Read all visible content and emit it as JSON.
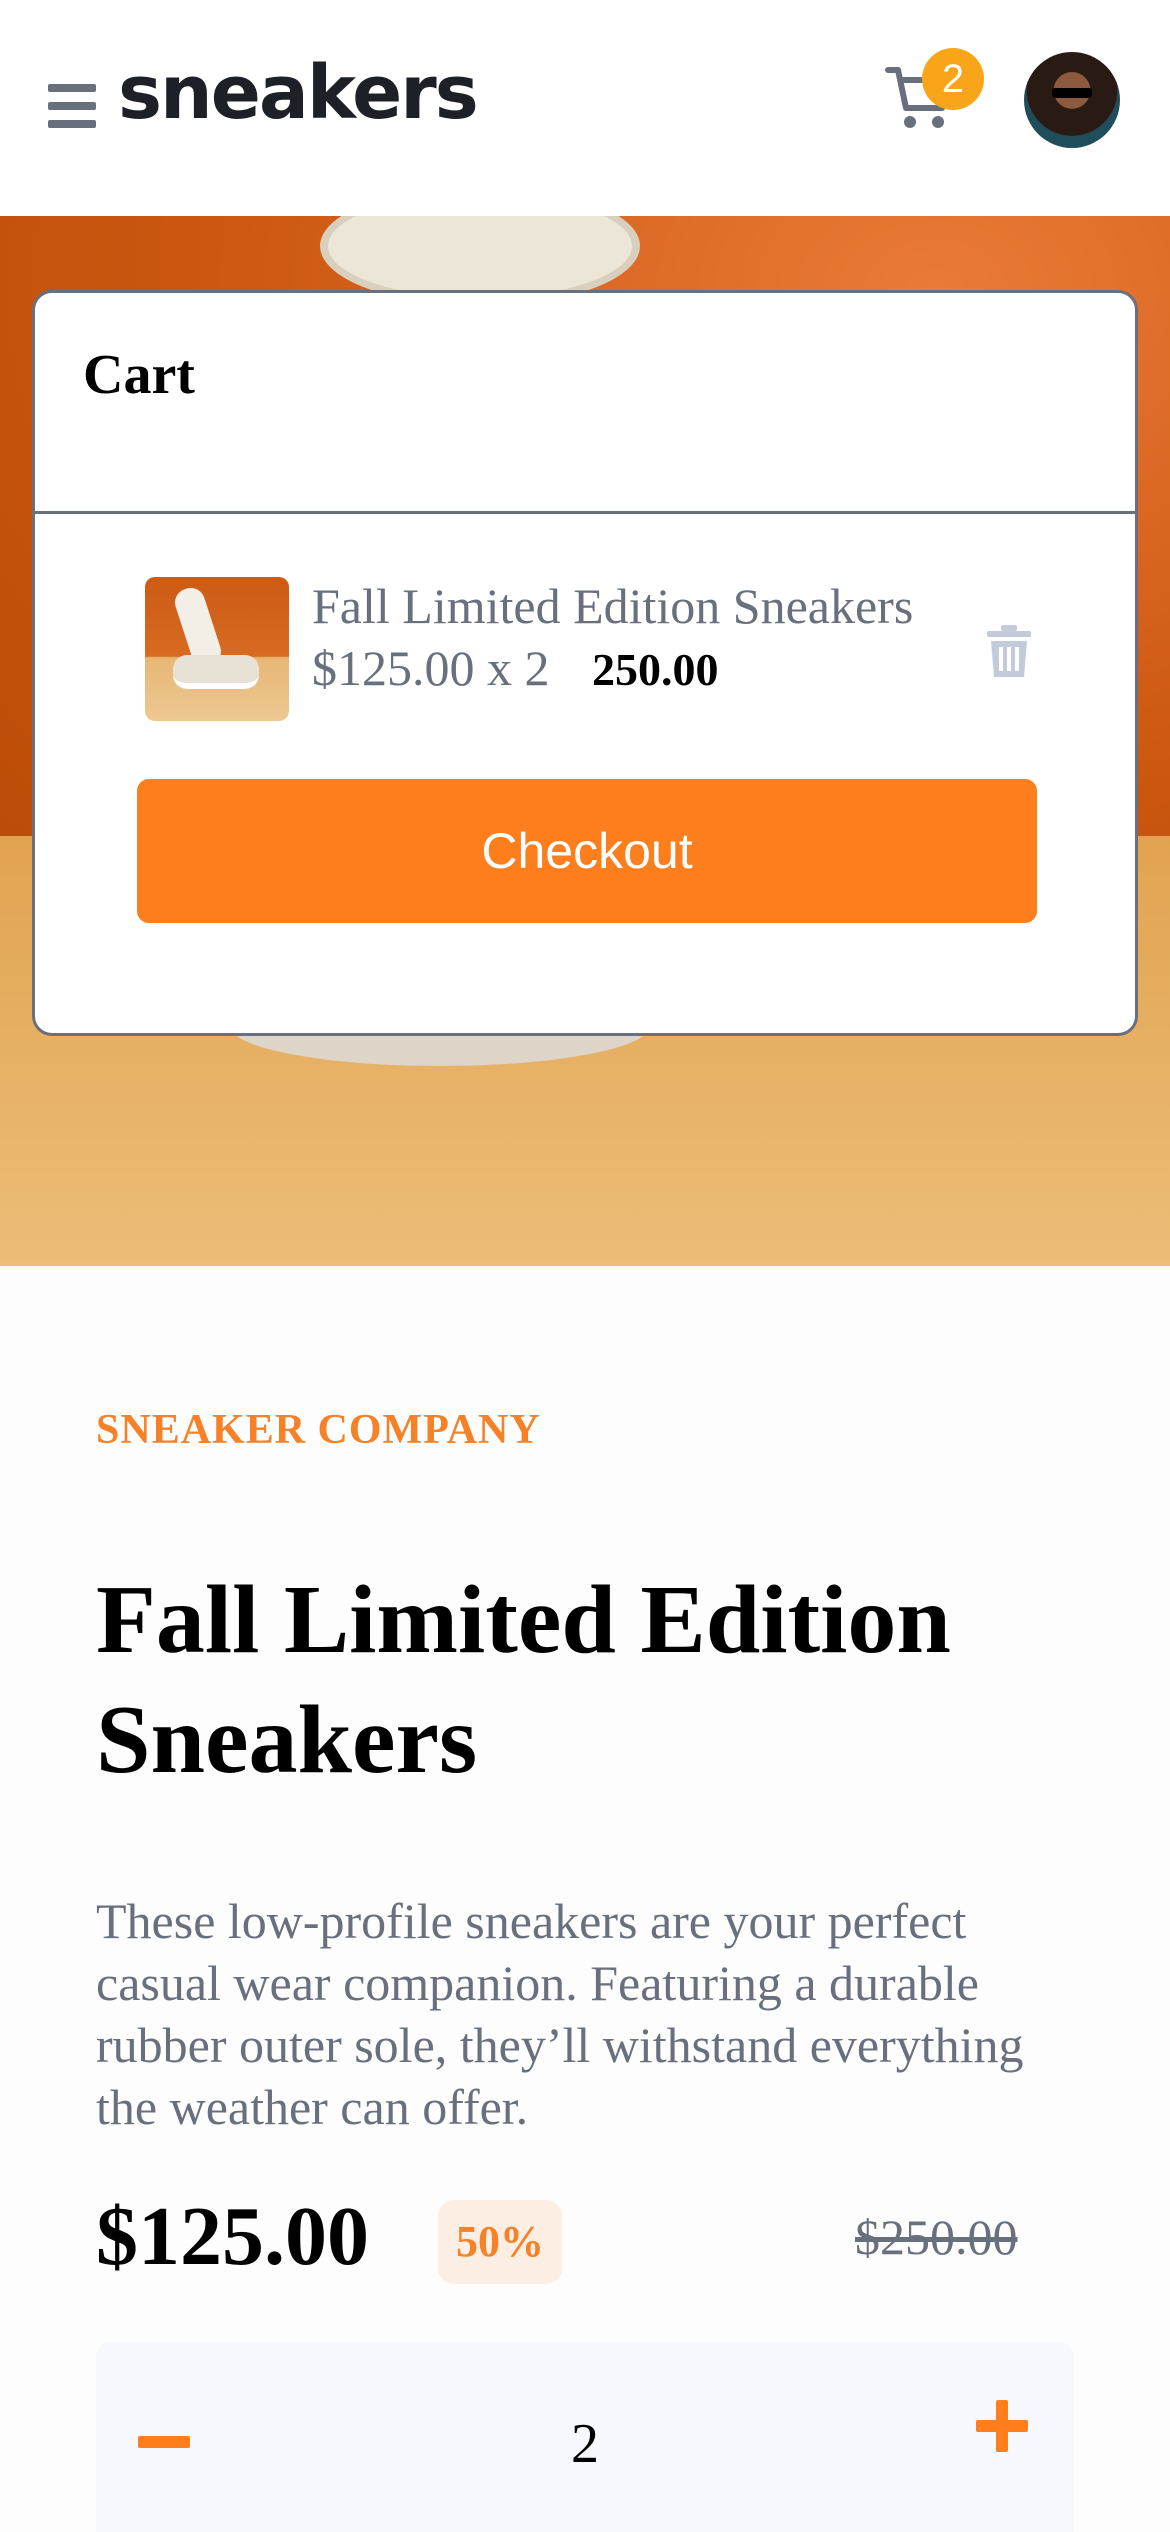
{
  "header": {
    "logo": "sneakers",
    "cart_count": "2"
  },
  "cart": {
    "title": "Cart",
    "item": {
      "name": "Fall Limited Edition Sneakers",
      "unit_price_qty": "$125.00 x 2",
      "line_total": "250.00"
    },
    "checkout_label": "Checkout"
  },
  "product": {
    "company": "SNEAKER COMPANY",
    "title": "Fall Limited Edition Sneakers",
    "description": "These low-profile sneakers are your perfect casual wear companion. Featuring a durable rubber outer sole, they’ll withstand everything the weather can offer.",
    "price": "$125.00",
    "discount": "50%",
    "original_price": "$250.00",
    "quantity": "2"
  },
  "colors": {
    "accent": "#fd7e1c",
    "badge": "#f8a51a",
    "muted_text": "#69707d",
    "discount_bg": "#fdeee3"
  },
  "icons": [
    "menu-icon",
    "cart-icon",
    "avatar",
    "trash-icon",
    "minus-icon",
    "plus-icon"
  ]
}
